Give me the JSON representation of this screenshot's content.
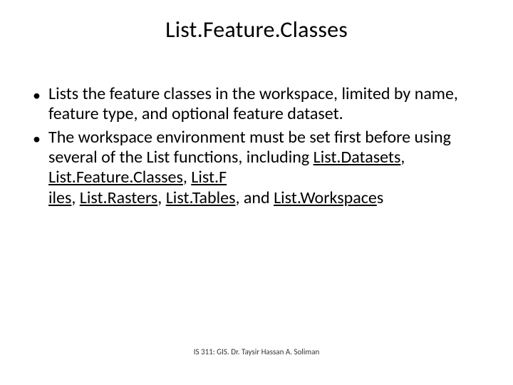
{
  "title": "List.Feature.Classes",
  "bullets": [
    {
      "text": "Lists the feature classes in the workspace, limited by name, feature type, and optional feature dataset."
    },
    {
      "prefix": "The workspace environment must be set first before using several of the List functions, including ",
      "links": {
        "l1": "List.Datasets",
        "sep1": ", ",
        "l2": "List.Feature.Classes",
        "sep2": ", ",
        "l3a": "List.F",
        "l3b": "iles",
        "sep3": ", ",
        "l4": "List.Rasters",
        "sep4": ", ",
        "l5": "List.Tables",
        "sep5": ", and ",
        "l6": "List.Workspace",
        "suffix": "s"
      }
    }
  ],
  "footer": "IS 311:  GIS. Dr. Taysir Hassan A. Soliman"
}
